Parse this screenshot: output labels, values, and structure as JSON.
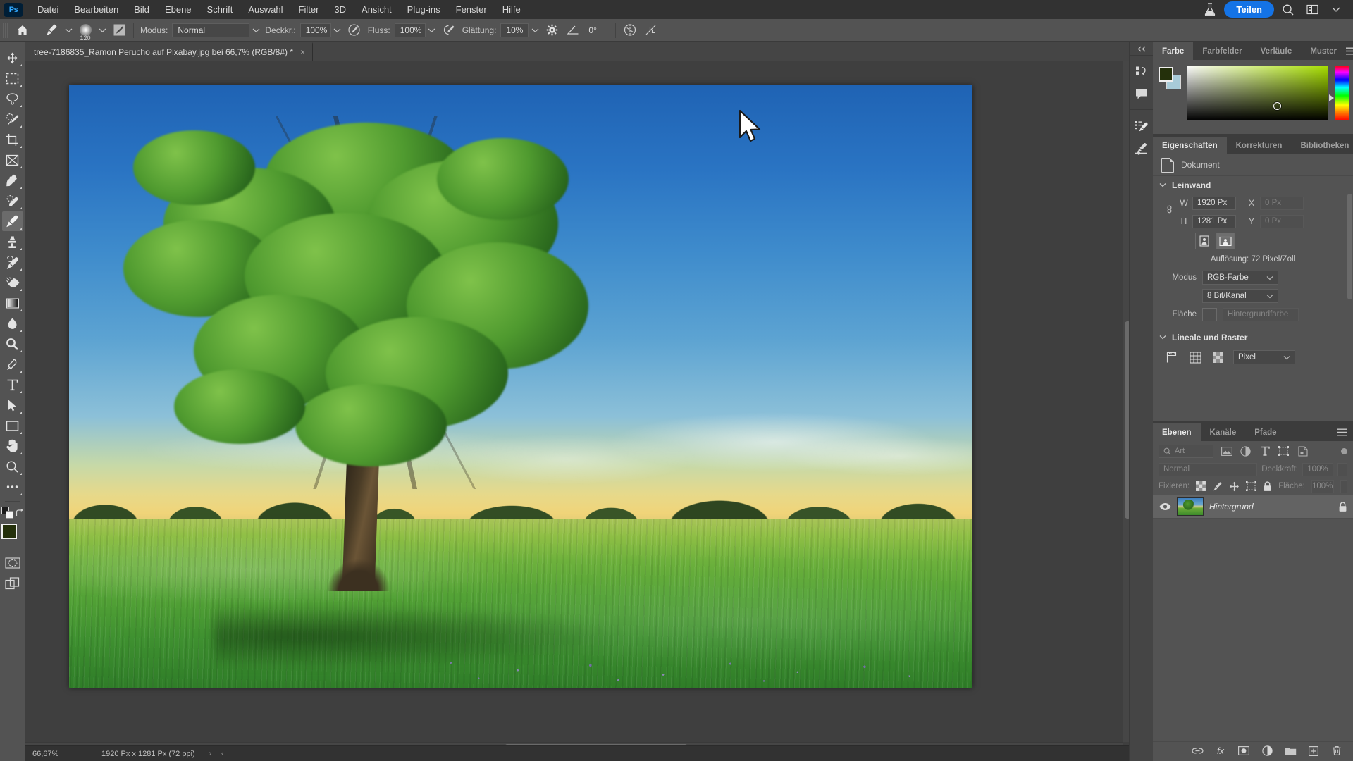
{
  "app": {
    "logo": "Ps",
    "menus": [
      "Datei",
      "Bearbeiten",
      "Bild",
      "Ebene",
      "Schrift",
      "Auswahl",
      "Filter",
      "3D",
      "Ansicht",
      "Plug-ins",
      "Fenster",
      "Hilfe"
    ],
    "share_label": "Teilen",
    "right_icons": [
      "flask-icon",
      "search-icon",
      "workspace-icon",
      "chevron-down-icon"
    ]
  },
  "options_bar": {
    "home_icon": "home-icon",
    "brush_tool_icon": "brush-icon",
    "brush_size": "120",
    "mode_label": "Modus:",
    "mode_value": "Normal",
    "opacity_label": "Deckkr.:",
    "opacity_value": "100%",
    "flow_label": "Fluss:",
    "flow_value": "100%",
    "smoothing_label": "Glättung:",
    "smoothing_value": "10%",
    "angle_value": "0°",
    "gear_icon": "gear-icon",
    "angle_icon": "angle-icon",
    "airbrush_icon": "airbrush-icon",
    "pressure_opacity_icon": "pressure-opacity-icon",
    "symmetry_icon": "symmetry-icon",
    "no_symmetry_icon": "no-symmetry-icon"
  },
  "document_tab": {
    "title": "tree-7186835_Ramon Perucho auf Pixabay.jpg bei 66,7% (RGB/8#) *",
    "close": "×"
  },
  "toolbar": {
    "tools": [
      {
        "name": "move-tool",
        "icon": "move-icon",
        "active": false
      },
      {
        "name": "marquee-tool",
        "icon": "rectangular-marquee-icon",
        "active": false
      },
      {
        "name": "lasso-tool",
        "icon": "lasso-icon",
        "active": false
      },
      {
        "name": "quick-selection-tool",
        "icon": "quick-selection-icon",
        "active": false
      },
      {
        "name": "crop-tool",
        "icon": "crop-icon",
        "active": false
      },
      {
        "name": "frame-tool",
        "icon": "frame-icon",
        "active": false
      },
      {
        "name": "eyedropper-tool",
        "icon": "eyedropper-icon",
        "active": false
      },
      {
        "name": "healing-brush-tool",
        "icon": "spot-healing-icon",
        "active": false
      },
      {
        "name": "brush-tool",
        "icon": "brush-icon",
        "active": true
      },
      {
        "name": "clone-stamp-tool",
        "icon": "clone-stamp-icon",
        "active": false
      },
      {
        "name": "history-brush-tool",
        "icon": "history-brush-icon",
        "active": false
      },
      {
        "name": "eraser-tool",
        "icon": "eraser-icon",
        "active": false
      },
      {
        "name": "gradient-tool",
        "icon": "gradient-icon",
        "active": false
      },
      {
        "name": "blur-tool",
        "icon": "blur-icon",
        "active": false
      },
      {
        "name": "dodge-tool",
        "icon": "dodge-icon",
        "active": false
      },
      {
        "name": "pen-tool",
        "icon": "pen-icon",
        "active": false
      },
      {
        "name": "type-tool",
        "icon": "type-icon",
        "active": false
      },
      {
        "name": "path-selection-tool",
        "icon": "path-selection-icon",
        "active": false
      },
      {
        "name": "rectangle-tool",
        "icon": "rectangle-icon",
        "active": false
      },
      {
        "name": "hand-tool",
        "icon": "hand-icon",
        "active": false
      },
      {
        "name": "zoom-tool",
        "icon": "zoom-icon",
        "active": false
      },
      {
        "name": "edit-toolbar",
        "icon": "ellipsis-icon",
        "active": false
      }
    ],
    "foreground_color": "#24300b",
    "background_color": "#a8cbd8",
    "default_colors_icon": "default-colors-icon",
    "swap_colors_icon": "swap-colors-icon",
    "quickmask_icon": "quick-mask-icon",
    "screenmode_icon": "screen-mode-icon"
  },
  "canvas": {
    "image_alt": "tree in a sunlit meadow under a blue sky",
    "cursor_icon": "mouse-cursor-arrow"
  },
  "statusbar": {
    "zoom": "66,67%",
    "doc_info": "1920 Px x 1281 Px (72 ppi)",
    "next_arrow": "›",
    "prev_arrow": "‹"
  },
  "rail": {
    "collapse_icon": "collapse-panels-icon",
    "groups": [
      [
        {
          "name": "history-icon"
        },
        {
          "name": "comments-icon"
        }
      ],
      [
        {
          "name": "actions-icon"
        },
        {
          "name": "brush-settings-icon"
        }
      ]
    ]
  },
  "color_panel": {
    "tabs": [
      {
        "label": "Farbe",
        "active": true
      },
      {
        "label": "Farbfelder",
        "active": false
      },
      {
        "label": "Verläufe",
        "active": false
      },
      {
        "label": "Muster",
        "active": false
      }
    ],
    "menu_icon": "panel-menu-icon",
    "foreground": "#24300b",
    "background": "#a8cbd8"
  },
  "properties_panel": {
    "tabs": [
      {
        "label": "Eigenschaften",
        "active": true
      },
      {
        "label": "Korrekturen",
        "active": false
      },
      {
        "label": "Bibliotheken",
        "active": false
      }
    ],
    "menu_icon": "panel-menu-icon",
    "doc_type_label": "Dokument",
    "doc_icon": "document-icon",
    "canvas_section": "Leinwand",
    "w_label": "W",
    "w_value": "1920 Px",
    "x_label": "X",
    "x_value": "0 Px",
    "h_label": "H",
    "h_value": "1281 Px",
    "y_label": "Y",
    "y_value": "0 Px",
    "link_icon": "link-dimensions-icon",
    "orientation_portrait_icon": "portrait-orientation-icon",
    "orientation_landscape_icon": "landscape-orientation-icon",
    "resolution_text": "Auflösung: 72 Pixel/Zoll",
    "mode_label": "Modus",
    "mode_value": "RGB-Farbe",
    "depth_value": "8 Bit/Kanal",
    "fill_label": "Fläche",
    "fill_value": "Hintergrundfarbe",
    "rulers_section": "Lineale und Raster",
    "ruler_icon": "ruler-icon",
    "grid_icon": "grid-icon",
    "transparency_icon": "transparency-grid-icon",
    "unit_value": "Pixel"
  },
  "layers_panel": {
    "tabs": [
      {
        "label": "Ebenen",
        "active": true
      },
      {
        "label": "Kanäle",
        "active": false
      },
      {
        "label": "Pfade",
        "active": false
      }
    ],
    "menu_icon": "panel-menu-icon",
    "filter_placeholder": "Art",
    "filter_icons": [
      "image-filter-icon",
      "adjustment-filter-icon",
      "type-filter-icon",
      "shape-filter-icon",
      "smartobject-filter-icon"
    ],
    "blend_mode": "Normal",
    "opacity_label": "Deckkraft:",
    "opacity_value": "100%",
    "lock_label": "Fixieren:",
    "lock_icons": [
      "lock-transparency-icon",
      "lock-pixels-icon",
      "lock-position-icon",
      "lock-artboard-icon",
      "lock-all-icon"
    ],
    "fill_label": "Fläche:",
    "fill_value": "100%",
    "layers": [
      {
        "name": "Hintergrund",
        "visible": true,
        "locked": true,
        "eye_icon": "eye-icon",
        "lock_icon": "lock-icon"
      }
    ],
    "bottom_icons": [
      "link-layers-icon",
      "layer-style-fx-icon",
      "layer-mask-icon",
      "adjustment-layer-icon",
      "new-group-icon",
      "new-layer-icon",
      "delete-layer-icon"
    ],
    "bottom_labels": [
      "∞",
      "fx",
      "▣",
      "◐",
      "▭",
      "+",
      "Ὕ1"
    ]
  }
}
